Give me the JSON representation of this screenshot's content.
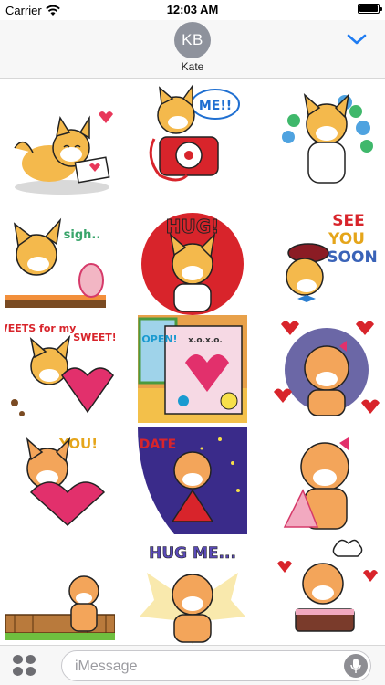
{
  "status_bar": {
    "carrier": "Carrier",
    "time": "12:03 AM",
    "battery_level": 1.0
  },
  "header": {
    "avatar_initials": "KB",
    "contact_name": "Kate",
    "chevron_icon": "chevron-down-icon",
    "accent_color": "#1f7cf2"
  },
  "stickers": {
    "me_bubble": "ME!!",
    "sigh": "sigh..",
    "hug": "HUG!",
    "see": "SEE",
    "you": "YOU",
    "soon": "SOON",
    "sweets_for_my": "SWEETS for my",
    "sweet": "SWEET!",
    "open": "OPEN!",
    "xoxo": "x.o.x.o.",
    "you_excl": "YOU!",
    "date": "DATE",
    "hug_me": "HUG ME..."
  },
  "input_bar": {
    "placeholder": "iMessage",
    "apps_icon": "app-drawer-icon",
    "mic_icon": "microphone-icon"
  }
}
